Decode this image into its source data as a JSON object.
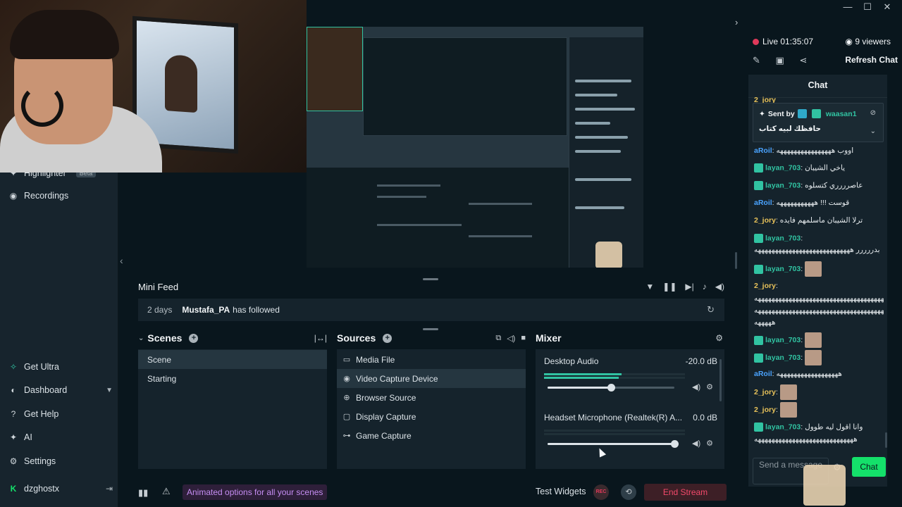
{
  "window": {
    "controls": [
      "—",
      "☐",
      "✕"
    ]
  },
  "nav": {
    "highlighter_label": "Highlighter",
    "highlighter_badge": "Beta",
    "recordings_label": "Recordings",
    "get_ultra_label": "Get Ultra",
    "dashboard_label": "Dashboard",
    "get_help_label": "Get Help",
    "ai_label": "AI",
    "settings_label": "Settings",
    "username": "dzghostx"
  },
  "minifeed": {
    "title": "Mini Feed",
    "event": {
      "time": "2 days",
      "user": "Mustafa_PA",
      "text": "has followed"
    }
  },
  "scenes": {
    "title": "Scenes",
    "items": [
      "Scene",
      "Starting"
    ],
    "selected": "Scene"
  },
  "sources": {
    "title": "Sources",
    "items": [
      {
        "label": "Media File",
        "icon": "media-file-icon"
      },
      {
        "label": "Video Capture Device",
        "icon": "webcam-icon"
      },
      {
        "label": "Browser Source",
        "icon": "globe-icon"
      },
      {
        "label": "Display Capture",
        "icon": "monitor-icon"
      },
      {
        "label": "Game Capture",
        "icon": "gamepad-icon"
      }
    ],
    "selected": "Video Capture Device"
  },
  "mixer": {
    "title": "Mixer",
    "channels": [
      {
        "name": "Desktop Audio",
        "db": "-20.0 dB",
        "level": 0.5
      },
      {
        "name": "Headset Microphone (Realtek(R) A...",
        "db": "0.0 dB",
        "level": 1.0
      }
    ]
  },
  "bottombar": {
    "animated_options": "Animated options for all your scenes",
    "test_widgets": "Test Widgets",
    "rec_label": "REC",
    "end_stream": "End Stream"
  },
  "chat": {
    "live_label": "Live",
    "live_time": "01:35:07",
    "viewers": "9 viewers",
    "refresh_label": "Refresh Chat",
    "title": "Chat",
    "top_user": "2_jory",
    "pinned": {
      "sent_by": "Sent by",
      "user": "waasan1",
      "text": "حافظك لبيه كتاب"
    },
    "messages": [
      {
        "user": "aRoil",
        "color": "#4aa3ff",
        "text": ": اووب ههههههههههههههههه"
      },
      {
        "user": "layan_703",
        "color": "#31c3a2",
        "text": ": ياخي الشيبان"
      },
      {
        "user": "layan_703",
        "color": "#31c3a2",
        "text": ": عاصرررري كتسلوه"
      },
      {
        "user": "aRoil",
        "color": "#4aa3ff",
        "text": ": قوست !!! هههههههههههه"
      },
      {
        "user": "2_jory",
        "color": "#e8c25a",
        "text": ": ترلا الشيبان ماسلمهم فايده"
      },
      {
        "user": "layan_703",
        "color": "#31c3a2",
        "text": ":"
      },
      {
        "user": "",
        "color": "#e6ebee",
        "text": "بدررررر ههههههههههههههههههههههههههههه"
      },
      {
        "user": "layan_703",
        "color": "#31c3a2",
        "text": ":"
      },
      {
        "user": "2_jory",
        "color": "#e8c25a",
        "text": ":"
      },
      {
        "user": "",
        "color": "#e6ebee",
        "text": "هههههههههههههههههههههههههههههههههههههههه"
      },
      {
        "user": "",
        "color": "#e6ebee",
        "text": "هههههههههههههههههههههههههههههههههههههههه"
      },
      {
        "user": "",
        "color": "#e6ebee",
        "text": "هههههه"
      },
      {
        "user": "layan_703",
        "color": "#31c3a2",
        "text": ":"
      },
      {
        "user": "layan_703",
        "color": "#31c3a2",
        "text": ":"
      },
      {
        "user": "aRoil",
        "color": "#4aa3ff",
        "text": ": ههههههههههههههههههه"
      },
      {
        "user": "2_jory",
        "color": "#e8c25a",
        "text": ":"
      },
      {
        "user": "2_jory",
        "color": "#e8c25a",
        "text": ":"
      },
      {
        "user": "layan_703",
        "color": "#31c3a2",
        "text": ": وانا اقول ليه طوول"
      },
      {
        "user": "",
        "color": "#e6ebee",
        "text": "هههههههههههههههههههههههههههههه"
      }
    ],
    "input_placeholder": "Send a message",
    "send_label": "Chat"
  },
  "colors": {
    "background": "#09161d",
    "panel": "#15232c",
    "accent_green": "#14e06a",
    "accent_teal": "#31c3a2",
    "live_red": "#e0395a",
    "end_stream_red": "#f2496a"
  }
}
